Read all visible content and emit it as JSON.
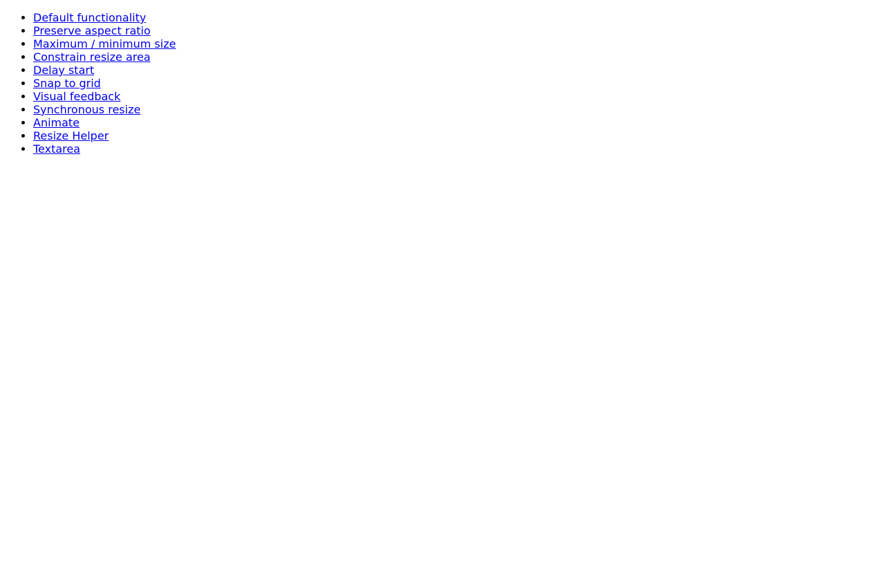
{
  "links": [
    "Default functionality",
    "Preserve aspect ratio",
    "Maximum / minimum size",
    "Constrain resize area",
    "Delay start",
    "Snap to grid",
    "Visual feedback",
    "Synchronous resize",
    "Animate",
    "Resize Helper",
    "Textarea"
  ],
  "colors": {
    "link": "#0000ee"
  }
}
